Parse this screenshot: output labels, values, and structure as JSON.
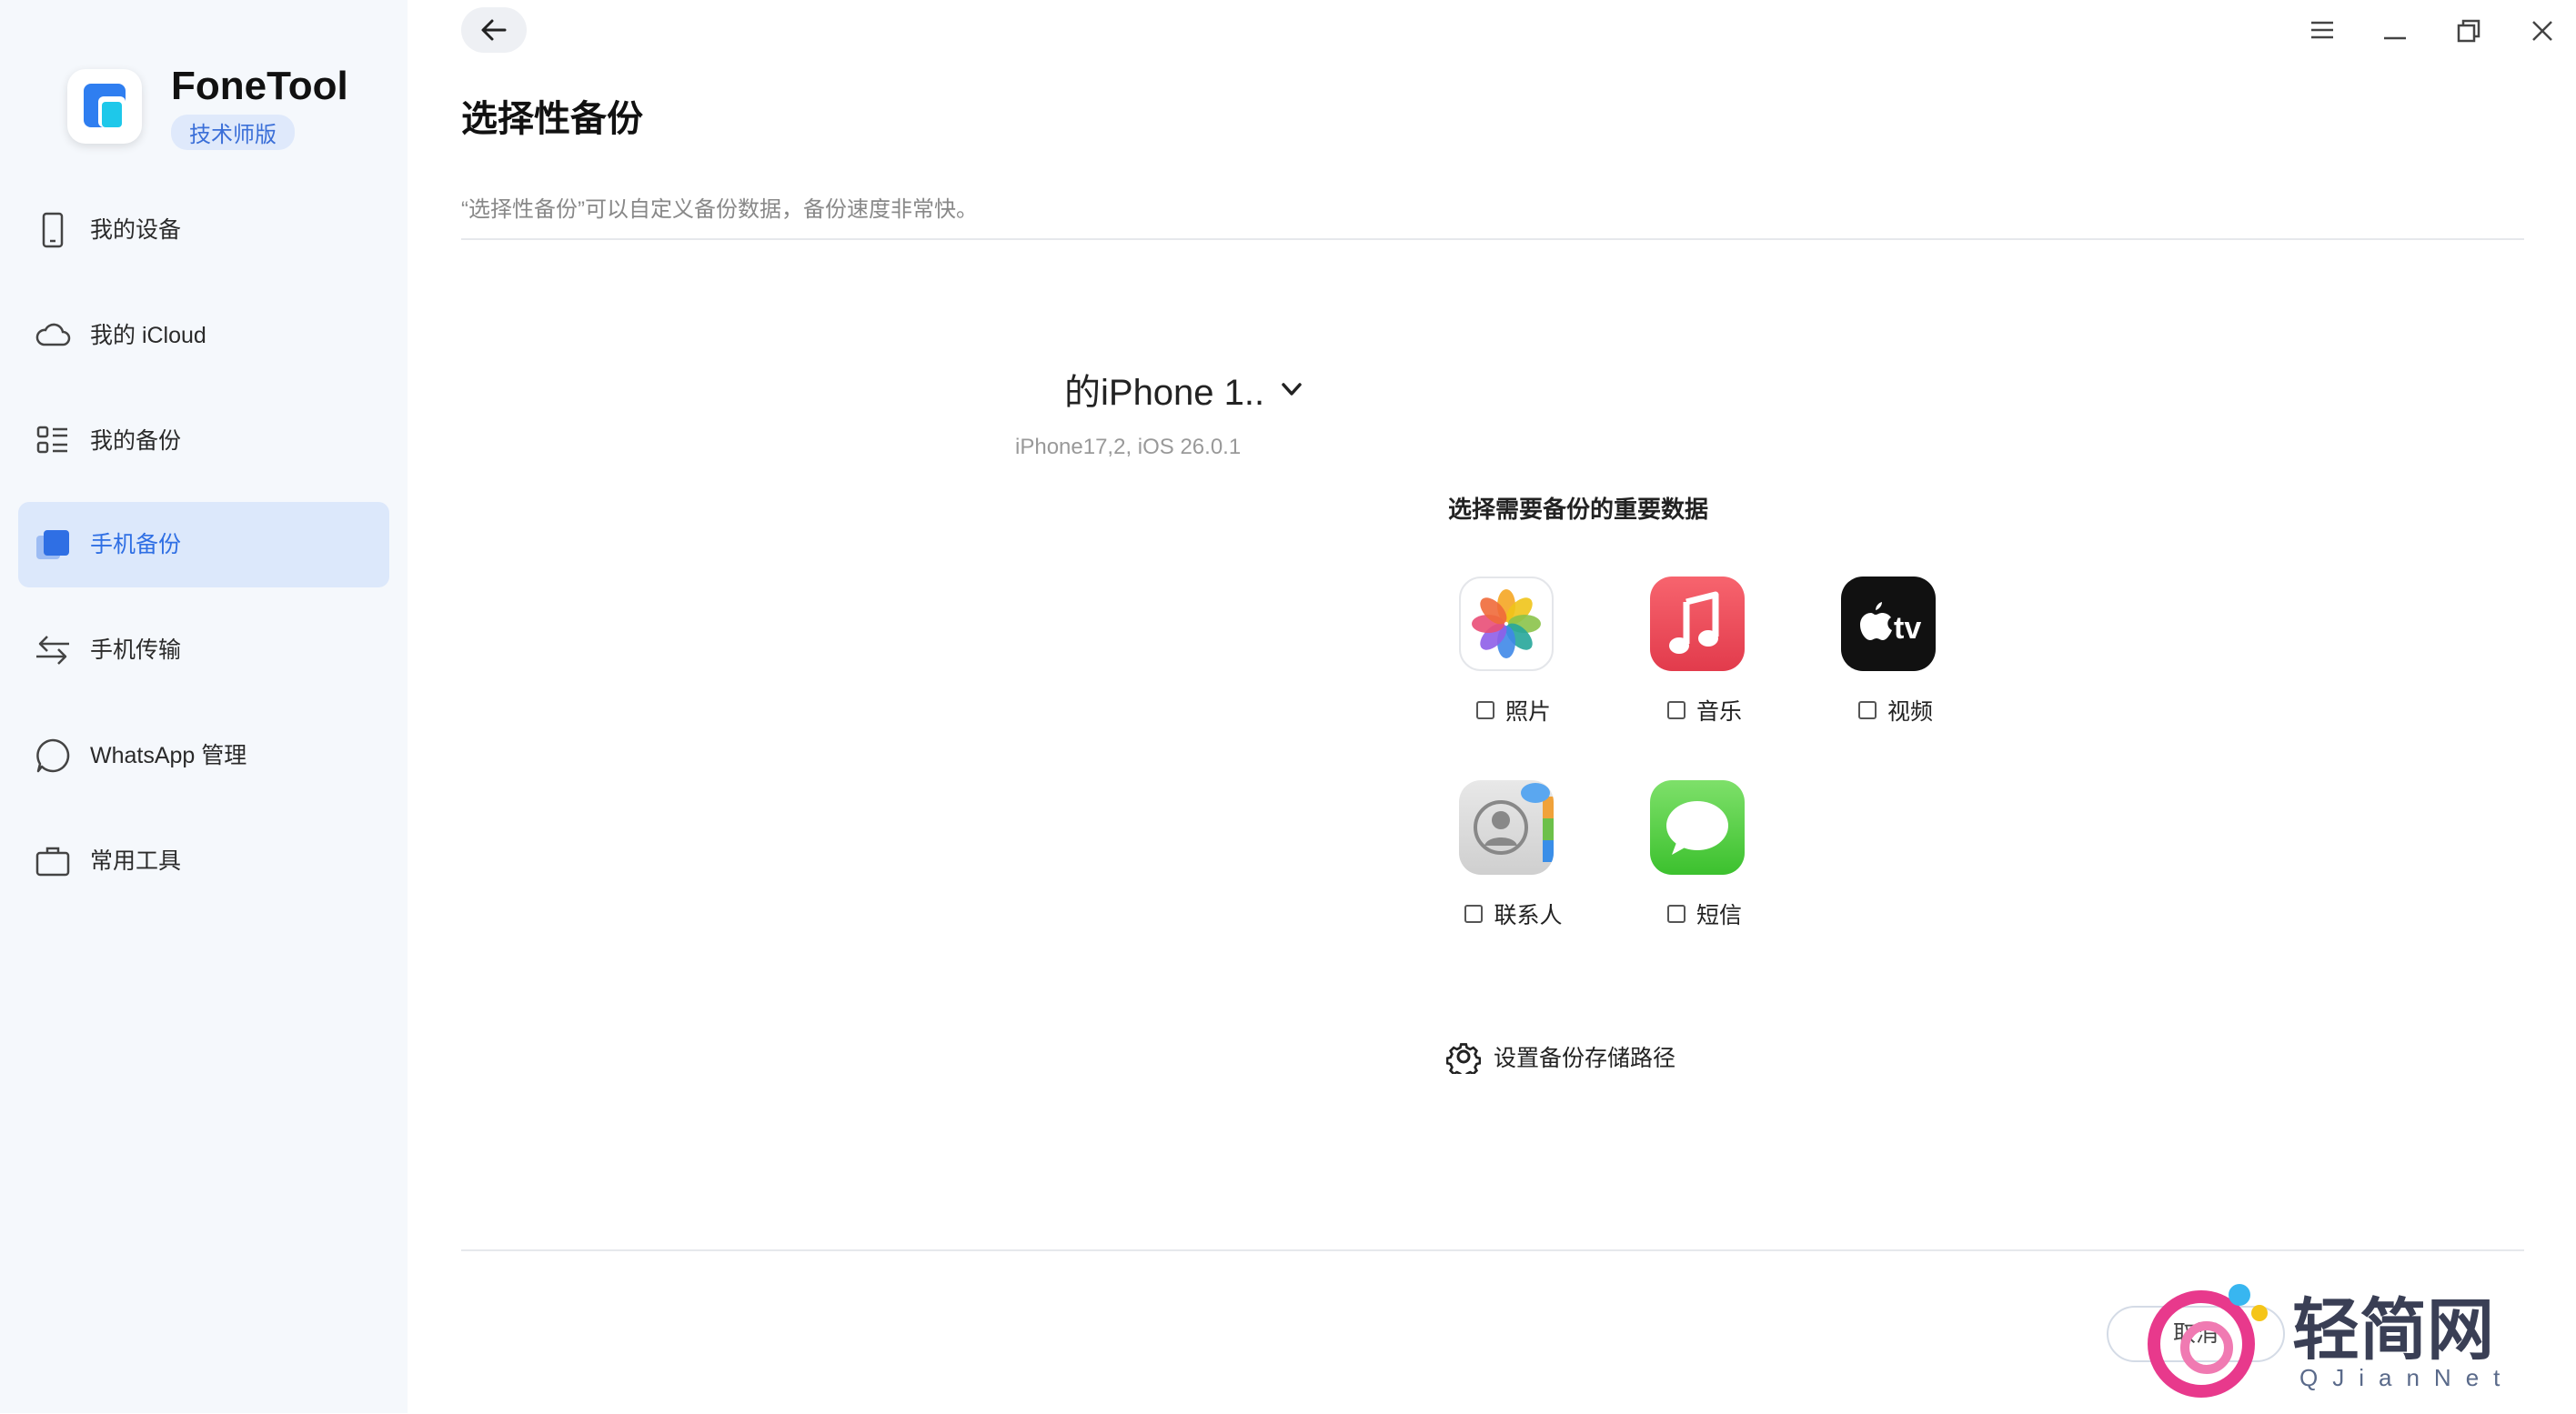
{
  "app": {
    "name": "FoneTool",
    "edition": "技术师版"
  },
  "sidebar": {
    "items": [
      {
        "label": "我的设备",
        "icon": "phone-icon"
      },
      {
        "label": "我的 iCloud",
        "icon": "cloud-icon"
      },
      {
        "label": "我的备份",
        "icon": "list-icon"
      },
      {
        "label": "手机备份",
        "icon": "backup-icon",
        "active": true
      },
      {
        "label": "手机传输",
        "icon": "transfer-icon"
      },
      {
        "label": "WhatsApp 管理",
        "icon": "chat-bubble-icon"
      },
      {
        "label": "常用工具",
        "icon": "toolbox-icon"
      }
    ]
  },
  "header": {
    "back_icon": "arrow-left-icon",
    "window_controls": [
      "menu-icon",
      "minimize-icon",
      "restore-icon",
      "close-icon"
    ]
  },
  "page": {
    "title": "选择性备份",
    "description": "“选择性备份”可以自定义备份数据，备份速度非常快。"
  },
  "device": {
    "name": "的iPhone 1..",
    "info": "iPhone17,2, iOS 26.0.1"
  },
  "data_section": {
    "title": "选择需要备份的重要数据",
    "items": [
      {
        "label": "照片",
        "icon": "photos-icon",
        "checked": false
      },
      {
        "label": "音乐",
        "icon": "music-icon",
        "checked": false
      },
      {
        "label": "视频",
        "icon": "apple-tv-icon",
        "checked": false
      },
      {
        "label": "联系人",
        "icon": "contacts-icon",
        "checked": false
      },
      {
        "label": "短信",
        "icon": "messages-icon",
        "checked": false
      }
    ],
    "apple_tv_text": "tv"
  },
  "settings": {
    "path_label": "设置备份存储路径"
  },
  "footer": {
    "cancel_label": "取消"
  },
  "watermark": {
    "title": "轻简网",
    "subtitle": "QJianNet"
  },
  "colors": {
    "accent": "#2f6fe4",
    "sidebar_bg": "#f5f8fc",
    "active_bg": "#dce8fb"
  }
}
